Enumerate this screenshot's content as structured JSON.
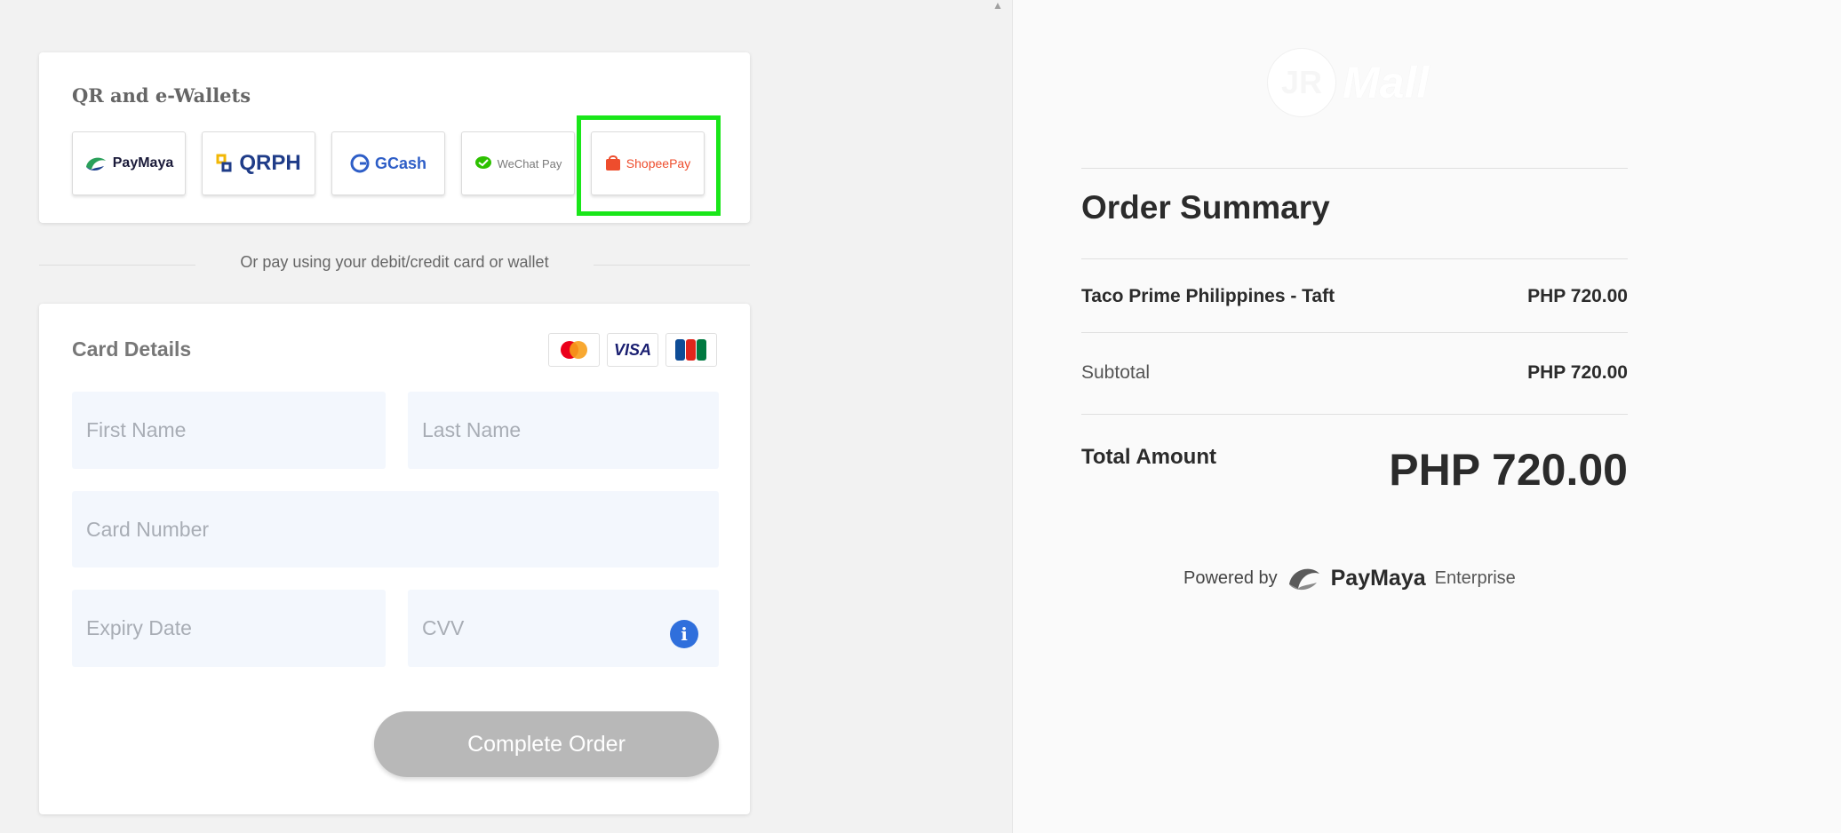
{
  "payment": {
    "qr_title": "QR and e-Wallets",
    "wallets": [
      {
        "label": "PayMaya"
      },
      {
        "label": "QRPH"
      },
      {
        "label": "GCash"
      },
      {
        "label": "WeChat Pay"
      },
      {
        "label": "ShopeePay"
      }
    ],
    "highlight_color": "#19e619",
    "divider_text": "Or pay using your debit/credit card or wallet"
  },
  "card_details": {
    "title": "Card Details",
    "card_brands": [
      "mastercard-icon",
      "VISA",
      "jcb-icon"
    ],
    "first_name_placeholder": "First Name",
    "last_name_placeholder": "Last Name",
    "card_number_placeholder": "Card Number",
    "expiry_placeholder": "Expiry Date",
    "cvv_placeholder": "CVV",
    "info_icon": "i",
    "submit_label": "Complete Order"
  },
  "merchant": {
    "logo_initials": "JR",
    "logo_text": "Mall"
  },
  "order_summary": {
    "title": "Order Summary",
    "item_name": "Taco Prime Philippines - Taft",
    "item_price": "PHP 720.00",
    "subtotal_label": "Subtotal",
    "subtotal_value": "PHP 720.00",
    "total_label": "Total Amount",
    "total_value": "PHP 720.00"
  },
  "footer": {
    "powered_label": "Powered by",
    "brand": "PayMaya",
    "suffix": "Enterprise"
  }
}
